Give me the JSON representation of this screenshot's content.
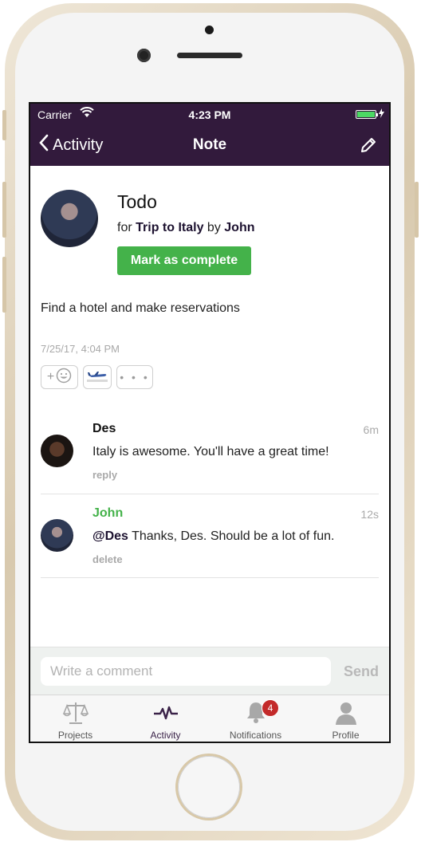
{
  "status_bar": {
    "carrier": "Carrier",
    "time": "4:23 PM"
  },
  "nav": {
    "back_label": "Activity",
    "title": "Note"
  },
  "note": {
    "title": "Todo",
    "sub_prefix": "for",
    "project": "Trip to Italy",
    "sub_by": "by",
    "author": "John",
    "complete_button": "Mark as complete",
    "body": "Find a hotel and make reservations",
    "date": "7/25/17, 4:04 PM",
    "reaction_add_label": "+",
    "more_label": "• • •"
  },
  "comments": [
    {
      "author": "Des",
      "time": "6m",
      "mention": "",
      "text": "Italy is awesome. You'll have a great time!",
      "action": "reply"
    },
    {
      "author": "John",
      "time": "12s",
      "mention": "@Des",
      "text": " Thanks, Des. Should be a lot of fun.",
      "action": "delete"
    }
  ],
  "comment_bar": {
    "placeholder": "Write a comment",
    "send_label": "Send"
  },
  "tabs": [
    {
      "label": "Projects",
      "icon": "scales-icon"
    },
    {
      "label": "Activity",
      "icon": "pulse-icon"
    },
    {
      "label": "Notifications",
      "icon": "bell-icon",
      "badge": "4"
    },
    {
      "label": "Profile",
      "icon": "person-icon"
    }
  ],
  "colors": {
    "brand": "#321a3c",
    "green": "#44b24a",
    "badge": "#c32a2a"
  }
}
